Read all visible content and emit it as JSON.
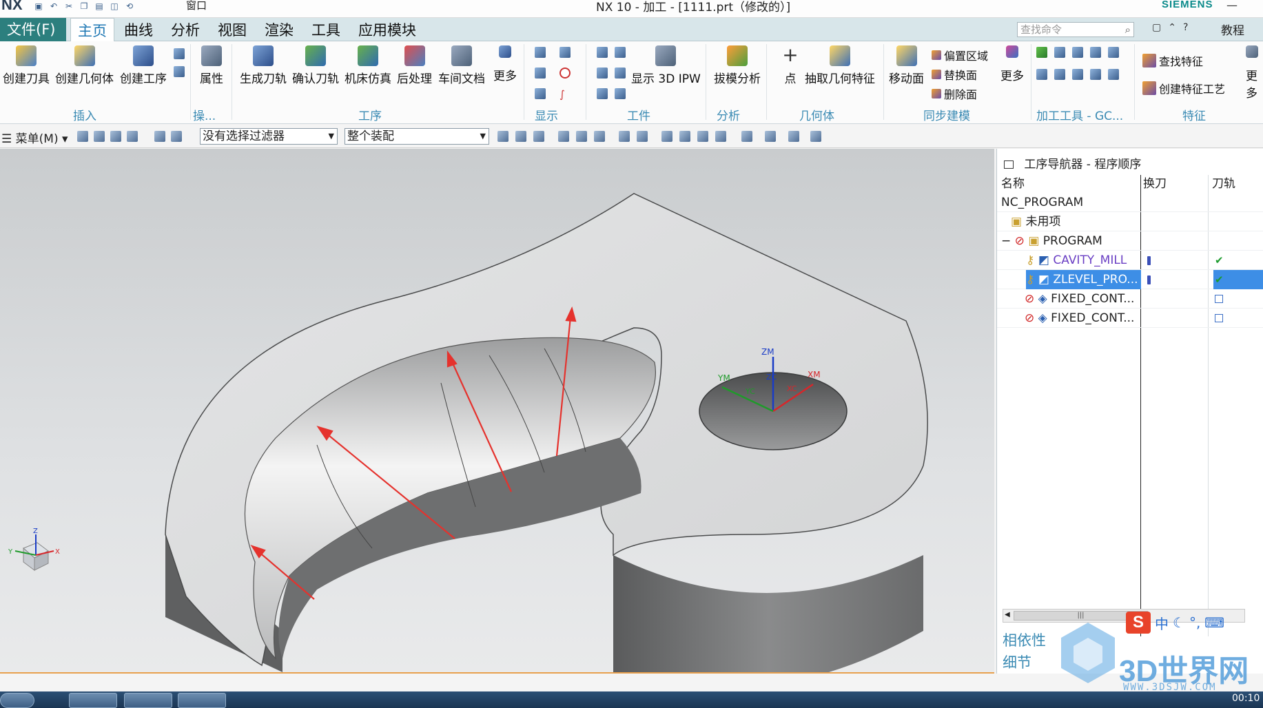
{
  "titlebar": {
    "logo": "NX",
    "window_menu": "窗口",
    "title": "NX 10 - 加工 - [1111.prt（修改的）]",
    "brand": "SIEMENS"
  },
  "tabs": {
    "file": "文件(F)",
    "items": [
      "主页",
      "曲线",
      "分析",
      "视图",
      "渲染",
      "工具",
      "应用模块"
    ],
    "active": "主页",
    "search_placeholder": "查找命令",
    "tutorial": "教程"
  },
  "ribbon": {
    "insert": {
      "label": "插入",
      "buttons": [
        "创建刀具",
        "创建几何体",
        "创建工序"
      ]
    },
    "ops_label": "操...",
    "attr_button": "属性",
    "process": {
      "label": "工序",
      "buttons": [
        "生成刀轨",
        "确认刀轨",
        "机床仿真",
        "后处理",
        "车间文档",
        "更多"
      ]
    },
    "display_label": "显示",
    "workpiece": {
      "label": "工件",
      "button": "显示 3D IPW"
    },
    "analysis": {
      "label": "分析",
      "button": "拔模分析"
    },
    "geometry": {
      "label": "几何体",
      "buttons": [
        "点",
        "抽取几何特征"
      ]
    },
    "sync": {
      "label": "同步建模",
      "button": "移动面",
      "small": [
        "偏置区域",
        "替换面",
        "删除面"
      ],
      "more": "更多"
    },
    "machining_tools_label": "加工工具 - GC...",
    "features": {
      "label": "特征",
      "buttons": [
        "查找特征",
        "创建特征工艺"
      ]
    },
    "more_right": "更多"
  },
  "toolbar": {
    "menu": "菜单(M)",
    "filter": "没有选择过滤器",
    "assembly": "整个装配"
  },
  "viewport": {
    "wcs_labels": [
      "ZM",
      "XM",
      "YM",
      "ZC",
      "XC",
      "YC"
    ],
    "triad_labels": [
      "Z",
      "Y",
      "X"
    ]
  },
  "navigator": {
    "title": "工序导航器 - 程序顺序",
    "columns": [
      "名称",
      "换刀",
      "刀轨"
    ],
    "rows": [
      {
        "name": "NC_PROGRAM"
      },
      {
        "name": "未用项"
      },
      {
        "name": "PROGRAM",
        "expander": "−"
      },
      {
        "name": "CAVITY_MILL",
        "toolpath": "✔"
      },
      {
        "name": "ZLEVEL_PRO...",
        "toolpath": "✔"
      },
      {
        "name": "FIXED_CONT..."
      },
      {
        "name": "FIXED_CONT..."
      }
    ],
    "selected_row": "ZLEVEL_PRO...",
    "sections": [
      "相依性",
      "细节"
    ]
  },
  "ime": {
    "logo": "S",
    "items": [
      "中",
      "☾",
      "°,",
      "⌨"
    ]
  },
  "watermark": {
    "text": "3D世界网",
    "url": "WWW.3DSJW.COM"
  },
  "taskbar": {
    "clock": "00:10"
  },
  "colors": {
    "accent": "#2c7f7e",
    "tab_bar": "#d8e6ea",
    "group_label": "#3a8ab3",
    "selection": "#3d8ee6",
    "arrow": "#e5322d"
  }
}
